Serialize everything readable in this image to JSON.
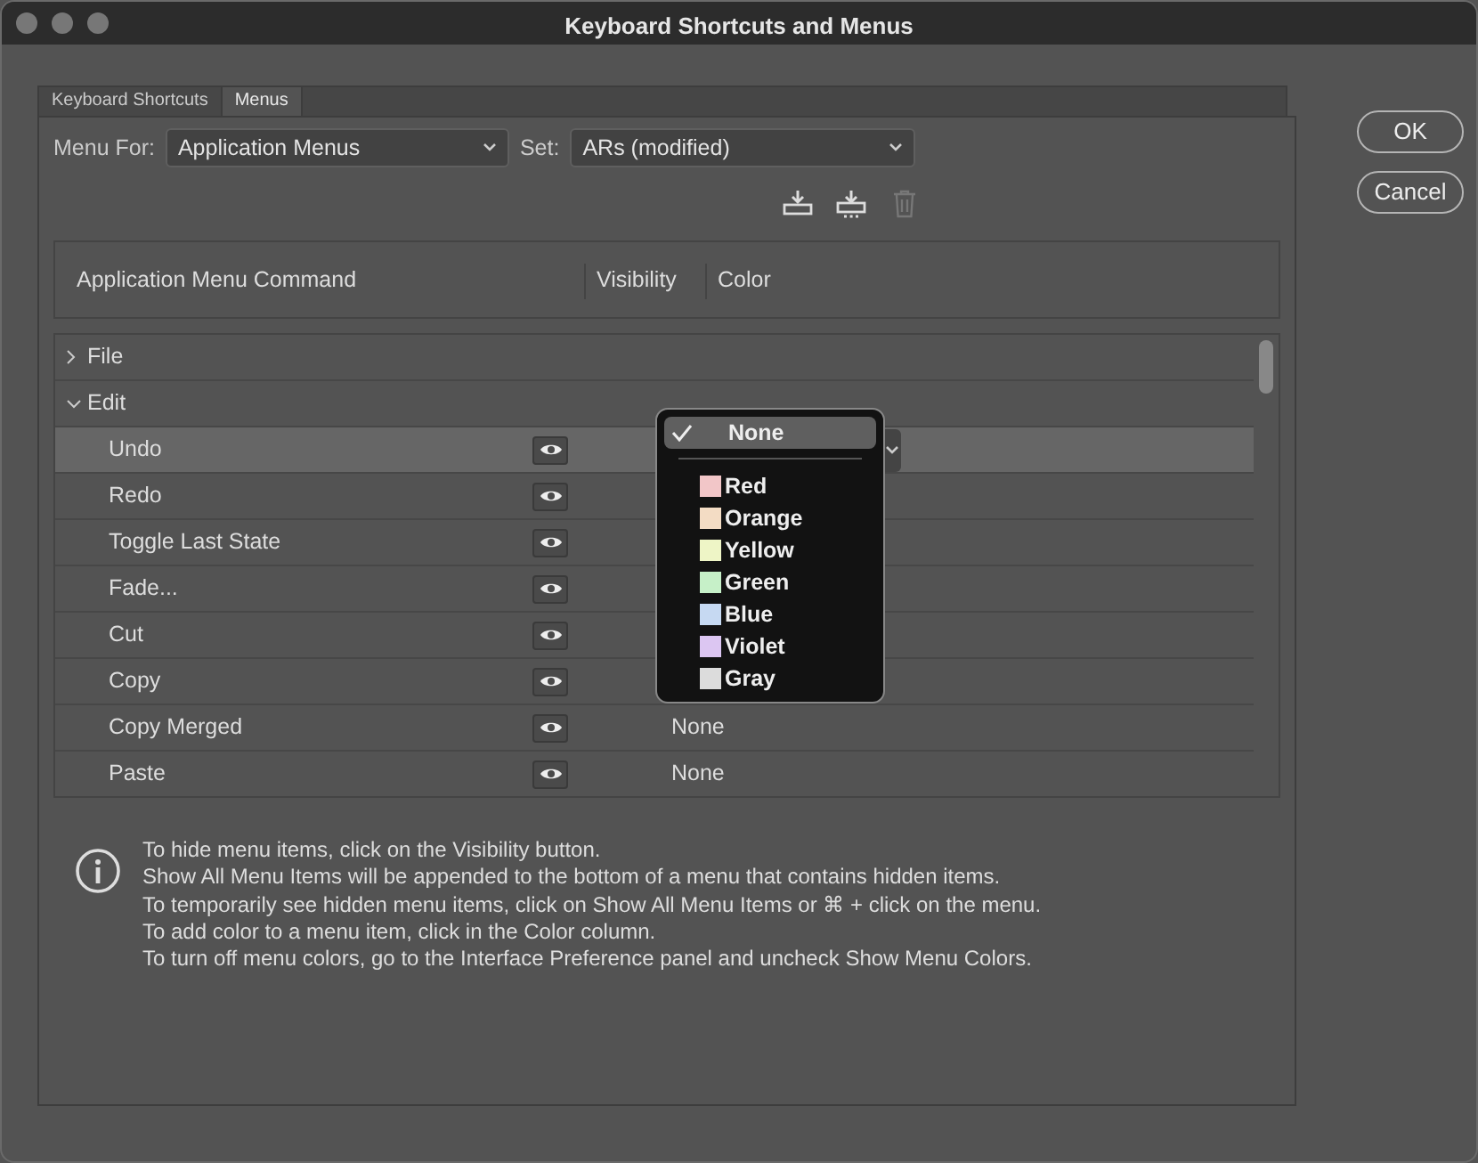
{
  "window": {
    "title": "Keyboard Shortcuts and Menus"
  },
  "tabs": [
    {
      "label": "Keyboard Shortcuts",
      "selected": false
    },
    {
      "label": "Menus",
      "selected": true
    }
  ],
  "menu_for": {
    "label": "Menu For:",
    "value": "Application Menus"
  },
  "set": {
    "label": "Set:",
    "value": "ARs (modified)"
  },
  "toolbar": [
    {
      "kind": "save",
      "disabled": false
    },
    {
      "kind": "save_as",
      "disabled": false
    },
    {
      "kind": "delete",
      "disabled": true
    }
  ],
  "columns": [
    "Application Menu Command",
    "Visibility",
    "Color"
  ],
  "tree": [
    {
      "label": "File",
      "expanded": false
    },
    {
      "label": "Edit",
      "expanded": true,
      "children": [
        {
          "label": "Undo",
          "selected": true,
          "visible": true
        },
        {
          "label": "Redo",
          "selected": false,
          "visible": true
        },
        {
          "label": "Toggle Last State",
          "selected": false,
          "visible": true
        },
        {
          "label": "Fade...",
          "selected": false,
          "visible": true
        },
        {
          "label": "Cut",
          "selected": false,
          "visible": true
        },
        {
          "label": "Copy",
          "selected": false,
          "visible": true
        },
        {
          "label": "Copy Merged",
          "selected": false,
          "visible": true,
          "color_label": "None"
        },
        {
          "label": "Paste",
          "selected": false,
          "visible": true,
          "color_label": "None"
        }
      ]
    }
  ],
  "color_menu": [
    {
      "label": "None",
      "selected": true
    },
    {
      "label": "Red",
      "selected": false,
      "color": "#f2c6c8"
    },
    {
      "label": "Orange",
      "selected": false,
      "color": "#f3dcc4"
    },
    {
      "label": "Yellow",
      "selected": false,
      "color": "#eef5c6"
    },
    {
      "label": "Green",
      "selected": false,
      "color": "#c6f0c8"
    },
    {
      "label": "Blue",
      "selected": false,
      "color": "#c6d9f2"
    },
    {
      "label": "Violet",
      "selected": false,
      "color": "#dcc6f2"
    },
    {
      "label": "Gray",
      "selected": false,
      "color": "#dcdcdc"
    }
  ],
  "info": [
    "To hide menu items, click on the Visibility button.",
    "Show All Menu Items will be appended to the bottom of a menu that contains hidden items.",
    "To temporarily see hidden menu items, click on Show All Menu Items or ⌘ + click on the menu.",
    "To add color to a menu item, click in the Color column.",
    "To turn off menu colors, go to the Interface Preference panel and uncheck Show Menu Colors."
  ],
  "buttons": [
    "OK",
    "Cancel"
  ]
}
